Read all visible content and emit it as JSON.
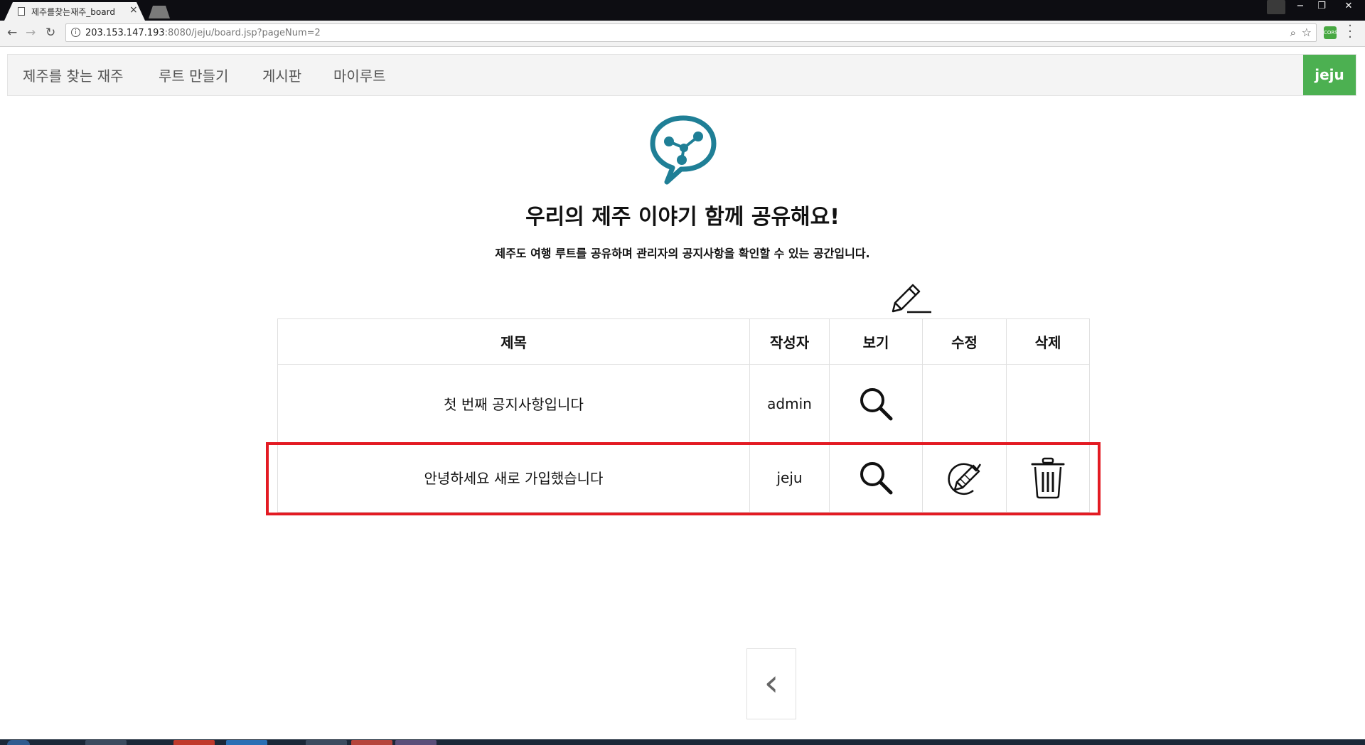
{
  "browser": {
    "tab_title": "제주를찾는재주_board",
    "tab_close": "×",
    "url_host": "203.153.147.193",
    "url_rest": ":8080/jeju/board.jsp?pageNum=2",
    "nav_back": "←",
    "nav_forward": "→",
    "nav_reload": "↻",
    "ext_label": "CORS",
    "window_buttons": {
      "minimize": "−",
      "restore": "❐",
      "close": "✕"
    }
  },
  "navbar": {
    "brand": "제주를 찾는 재주",
    "items": [
      {
        "label": "루트 만들기"
      },
      {
        "label": "게시판"
      },
      {
        "label": "마이루트"
      }
    ],
    "user": "jeju"
  },
  "header": {
    "title": "우리의 제주 이야기 함께 공유해요!",
    "subtitle": "제주도 여행 루트를 공유하며 관리자의 공지사항을 확인할 수 있는 공간입니다."
  },
  "table": {
    "columns": [
      "제목",
      "작성자",
      "보기",
      "수정",
      "삭제"
    ],
    "rows": [
      {
        "title": "첫 번째 공지사항입니다",
        "author": "admin",
        "can_edit": false,
        "can_delete": false
      },
      {
        "title": "안녕하세요 새로 가입했습니다",
        "author": "jeju",
        "can_edit": true,
        "can_delete": true
      }
    ]
  },
  "pagination": {
    "prev": "‹"
  },
  "colors": {
    "accent_green": "#4cb051",
    "logo_teal": "#1f7f96",
    "highlight_red": "#e31b23"
  },
  "icons": [
    "chat-share-logo-icon",
    "pencil-write-icon",
    "magnifier-icon",
    "edit-refresh-icon",
    "trash-icon"
  ]
}
